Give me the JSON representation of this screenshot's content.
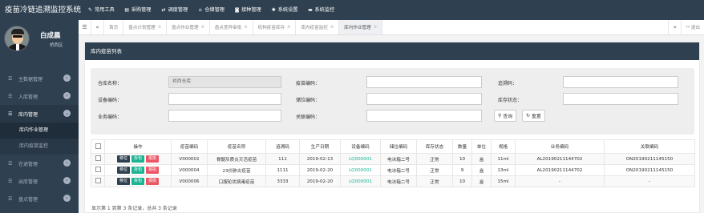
{
  "app": {
    "title": "疫苗冷链追溯监控系统"
  },
  "topnav": [
    {
      "label": "常用工具",
      "icon": "wrench-icon",
      "glyph": "✎"
    },
    {
      "label": "采购管理",
      "icon": "document-icon",
      "glyph": "▤"
    },
    {
      "label": "调度管理",
      "icon": "exchange-icon",
      "glyph": "⇄"
    },
    {
      "label": "仓储管理",
      "icon": "home-icon",
      "glyph": "⌂"
    },
    {
      "label": "接种管理",
      "icon": "camera-icon",
      "glyph": "◙"
    },
    {
      "label": "系统设置",
      "icon": "gear-icon",
      "glyph": "✱"
    },
    {
      "label": "系统监控",
      "icon": "monitor-icon",
      "glyph": "▬"
    }
  ],
  "user": {
    "name": "白成晨",
    "role": "桥西区"
  },
  "sidebar": {
    "items": [
      {
        "label": "主数据管理"
      },
      {
        "label": "入库管理"
      },
      {
        "label": "库内管理",
        "open": true
      }
    ],
    "sub": [
      {
        "label": "库内作业管理",
        "active": true
      },
      {
        "label": "库内疫苗监控"
      }
    ],
    "items_after": [
      {
        "label": "在途管理"
      },
      {
        "label": "出库管理"
      },
      {
        "label": "盘点管理"
      }
    ]
  },
  "tabs": [
    {
      "label": "首页"
    },
    {
      "label": "盘点计划管理"
    },
    {
      "label": "盘点作业管理"
    },
    {
      "label": "盘点差异审批"
    },
    {
      "label": "机构疫苗库存"
    },
    {
      "label": "库内疫苗监控"
    },
    {
      "label": "库内作业管理",
      "active": true
    }
  ],
  "logout_label": "退出",
  "panel": {
    "title": "库内疫苗列表"
  },
  "form": {
    "warehouse_label": "仓库名称：",
    "warehouse_value": "桥西仓库",
    "vaccine_code_label": "疫苗编码：",
    "trace_code_label": "追溯码：",
    "device_code_label": "设备编码：",
    "location_code_label": "储位编码：",
    "status_label": "库存状态：",
    "business_code_label": "业务编码：",
    "related_code_label": "关联编码：",
    "query_label": "查询",
    "reset_label": "重置"
  },
  "table": {
    "headers": [
      "操作",
      "疫苗编码",
      "疫苗名称",
      "追溯码",
      "生产日期",
      "设备编码",
      "储位编码",
      "库存状态",
      "数量",
      "单位",
      "规格",
      "业务编码",
      "关联编码"
    ],
    "op_labels": [
      "移位",
      "拆包",
      "报损"
    ],
    "rows": [
      [
        "V000002",
        "脊髓灰质炎灭活疫苗",
        "111",
        "2019-02-13",
        "LQ000001",
        "电冰箱二号",
        "正常",
        "10",
        "盒",
        "11ml",
        "AL20190211144702",
        "ON20190211145150"
      ],
      [
        "V000004",
        "23价肺炎疫苗",
        "1111",
        "2019-02-20",
        "LQ000001",
        "电冰箱二号",
        "正常",
        "9",
        "盒",
        "13ml",
        "AL20190211144702",
        "ON20190211145150"
      ],
      [
        "V000006",
        "口服轮状病毒疫苗",
        "3333",
        "2019-02-20",
        "LQ000001",
        "电冰箱二号",
        "正常",
        "10",
        "盒",
        "15ml",
        "-",
        "-"
      ]
    ]
  },
  "footer": {
    "text": "显示第 1 到第 3 条记录，总共 3 条记录"
  }
}
